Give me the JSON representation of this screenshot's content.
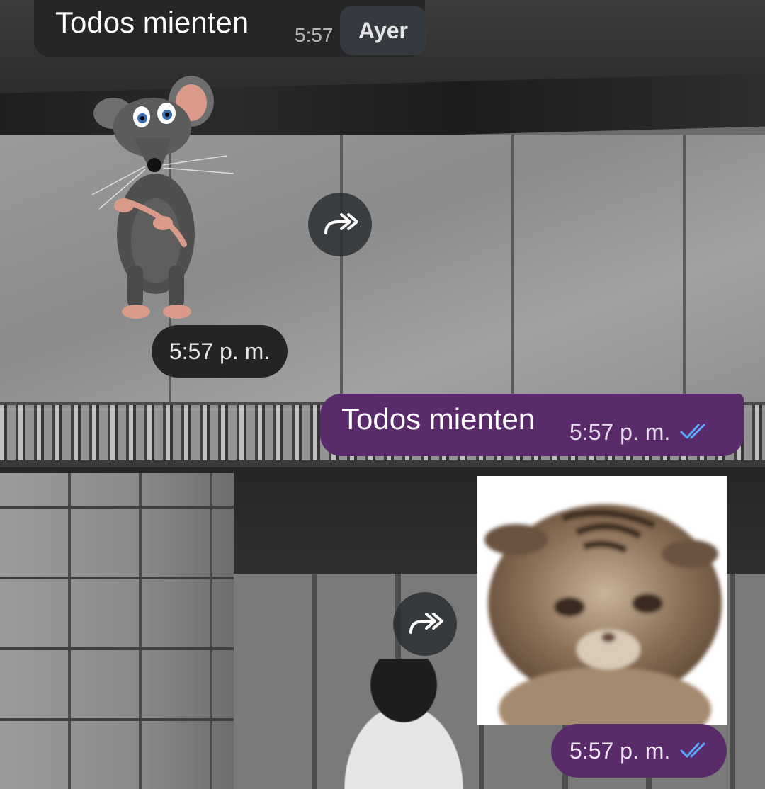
{
  "chat": {
    "incoming_text_message": {
      "text": "Todos mienten",
      "time": "5:57"
    },
    "date_chip": "Ayer",
    "rat_sticker": {
      "time": "5:57 p. m."
    },
    "outgoing_text_message": {
      "text": "Todos mienten",
      "time": "5:57 p. m.",
      "status": "read"
    },
    "cat_sticker": {
      "time": "5:57 p. m.",
      "status": "read"
    }
  },
  "icons": {
    "forward": "forward-arrow-icon",
    "read_receipt": "double-check-icon"
  },
  "colors": {
    "outgoing_bubble": "#5a2b6b",
    "incoming_bubble": "#262626",
    "read_check": "#5aa7ff"
  }
}
